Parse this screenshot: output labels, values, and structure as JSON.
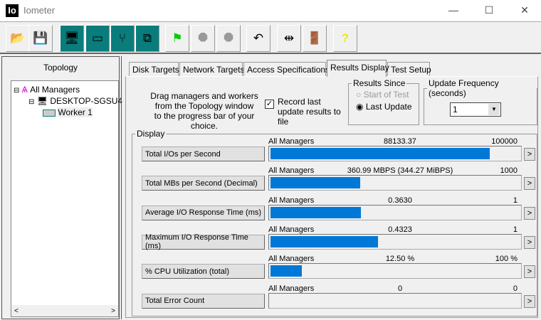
{
  "window": {
    "title": "Iometer",
    "icon_label": "Io"
  },
  "toolbar": [
    {
      "name": "open-icon",
      "glyph": "📂"
    },
    {
      "name": "save-icon",
      "glyph": "💾"
    },
    {
      "name": "new-manager-icon",
      "glyph": "🖥"
    },
    {
      "name": "new-disk-worker-icon",
      "glyph": "▭"
    },
    {
      "name": "new-network-worker-icon",
      "glyph": "⑂"
    },
    {
      "name": "copy-worker-icon",
      "glyph": "⧉"
    },
    {
      "name": "start-icon",
      "glyph": "⚑"
    },
    {
      "name": "stop-icon",
      "glyph": "⯃"
    },
    {
      "name": "stop-all-icon",
      "glyph": "⯃"
    },
    {
      "name": "reset-icon",
      "glyph": "↶"
    },
    {
      "name": "disconnect-icon",
      "glyph": "⇹"
    },
    {
      "name": "exit-icon",
      "glyph": "🚪"
    },
    {
      "name": "help-icon",
      "glyph": "?"
    }
  ],
  "topology": {
    "title": "Topology",
    "items": [
      "All Managers",
      "DESKTOP-SGSU4",
      "Worker 1"
    ]
  },
  "tabs": [
    "Disk Targets",
    "Network Targets",
    "Access Specifications",
    "Results Display",
    "Test Setup"
  ],
  "results": {
    "instructions": [
      "Drag managers and workers",
      "from the Topology window",
      "to the progress bar of your choice."
    ],
    "record_label": "Record last update results to file",
    "record_checked": true,
    "since_title": "Results Since",
    "since_options": [
      "Start of Test",
      "Last Update"
    ],
    "since_selected": "Last Update",
    "freq_title": "Update Frequency (seconds)",
    "freq_value": "1",
    "display_title": "Display",
    "metrics": [
      {
        "label": "Total I/Os per Second",
        "source": "All Managers",
        "value": "88133.37",
        "max": "100000",
        "fraction": 0.881
      },
      {
        "label": "Total MBs per Second (Decimal)",
        "source": "All Managers",
        "value": "360.99 MBPS (344.27 MiBPS)",
        "max": "1000",
        "fraction": 0.361
      },
      {
        "label": "Average I/O Response Time (ms)",
        "source": "All Managers",
        "value": "0.3630",
        "max": "1",
        "fraction": 0.363
      },
      {
        "label": "Maximum I/O Response Time (ms)",
        "source": "All Managers",
        "value": "0.4323",
        "max": "1",
        "fraction": 0.432
      },
      {
        "label": "% CPU Utilization (total)",
        "source": "All Managers",
        "value": "12.50 %",
        "max": "100 %",
        "fraction": 0.125
      },
      {
        "label": "Total Error Count",
        "source": "All Managers",
        "value": "0",
        "max": "0",
        "fraction": 0
      }
    ],
    "arrow": ">"
  }
}
